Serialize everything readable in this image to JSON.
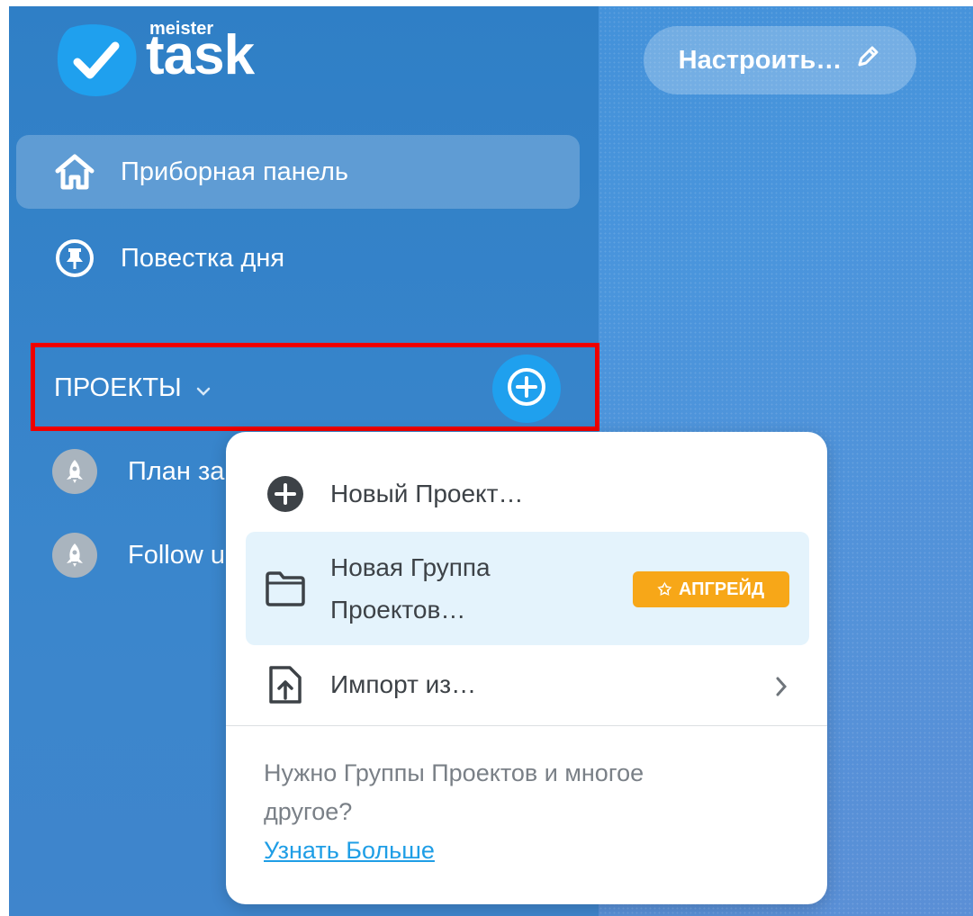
{
  "app": {
    "logo_small": "meister",
    "logo_large": "task",
    "brand_color": "#1fa0ee"
  },
  "nav": {
    "items": [
      {
        "label": "Приборная панель",
        "icon": "home-icon",
        "active": true
      },
      {
        "label": "Повестка дня",
        "icon": "pin-icon",
        "active": false
      }
    ]
  },
  "projects": {
    "header_label": "ПРОЕКТЫ",
    "list": [
      {
        "label": "План за",
        "icon": "rocket-icon"
      },
      {
        "label": "Follow u",
        "icon": "rocket-icon"
      }
    ]
  },
  "toolbar": {
    "customize_label": "Настроить…"
  },
  "dropdown": {
    "new_project": "Новый Проект…",
    "new_group_line1": "Новая Группа",
    "new_group_line2": "Проектов…",
    "upgrade_badge": "АПГРЕЙД",
    "import_label": "Импорт из…",
    "footer_text_line1": "Нужно Группы Проектов и многое",
    "footer_text_line2": "другое?",
    "learn_more": "Узнать Больше"
  }
}
